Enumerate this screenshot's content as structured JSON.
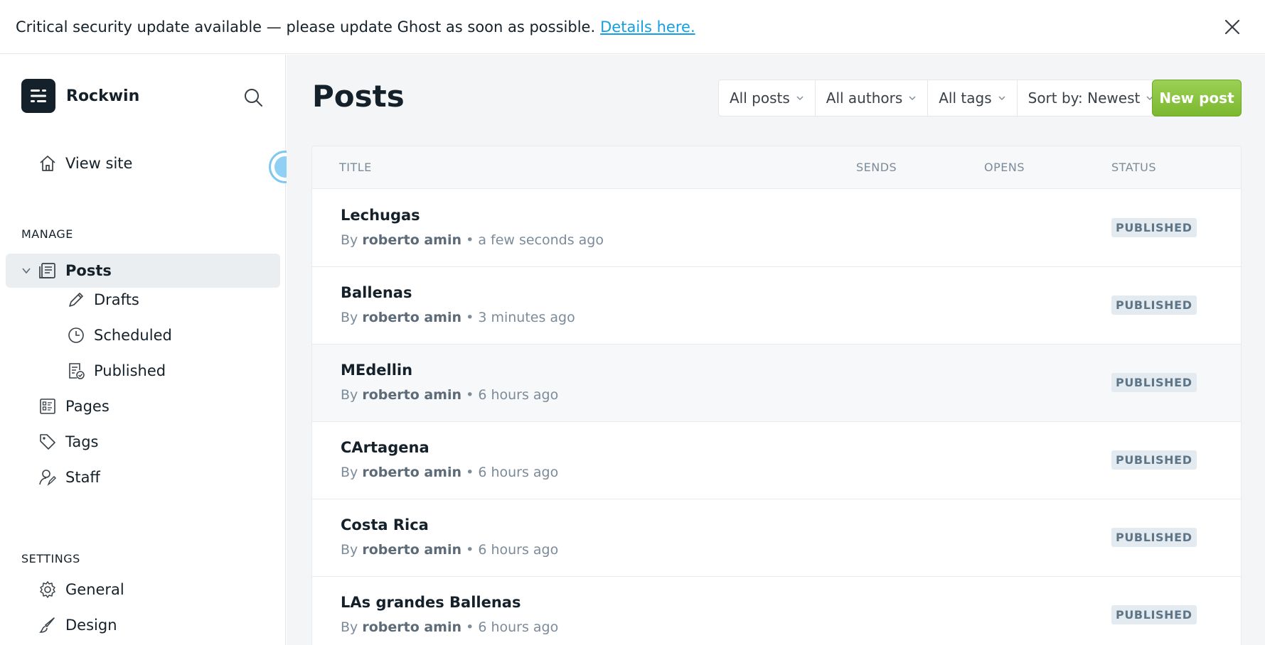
{
  "banner": {
    "message": "Critical security update available — please update Ghost as soon as possible.",
    "link": "Details here."
  },
  "sidebar": {
    "brand": "Rockwin",
    "view_site": "View site",
    "manage_label": "MANAGE",
    "posts": "Posts",
    "drafts": "Drafts",
    "scheduled": "Scheduled",
    "published": "Published",
    "pages": "Pages",
    "tags": "Tags",
    "staff": "Staff",
    "settings_label": "SETTINGS",
    "general": "General",
    "design": "Design"
  },
  "main": {
    "title": "Posts",
    "filters": [
      "All posts",
      "All authors",
      "All tags",
      "Sort by: Newest"
    ],
    "new_post": "New post",
    "columns": {
      "title": "TITLE",
      "sends": "SENDS",
      "opens": "OPENS",
      "status": "STATUS"
    },
    "posts": [
      {
        "title": "Lechugas",
        "by": "By",
        "author": "roberto amin",
        "time": "• a few seconds ago",
        "status": "PUBLISHED"
      },
      {
        "title": "Ballenas",
        "by": "By",
        "author": "roberto amin",
        "time": "• 3 minutes ago",
        "status": "PUBLISHED"
      },
      {
        "title": "MEdellin",
        "by": "By",
        "author": "roberto amin",
        "time": "• 6 hours ago",
        "status": "PUBLISHED"
      },
      {
        "title": "CArtagena",
        "by": "By",
        "author": "roberto amin",
        "time": "• 6 hours ago",
        "status": "PUBLISHED"
      },
      {
        "title": "Costa Rica",
        "by": "By",
        "author": "roberto amin",
        "time": "• 6 hours ago",
        "status": "PUBLISHED"
      },
      {
        "title": "LAs grandes Ballenas",
        "by": "By",
        "author": "roberto amin",
        "time": "• 6 hours ago",
        "status": "PUBLISHED"
      }
    ]
  },
  "colors": {
    "accent_green": "#8bc34a",
    "link_blue": "#14a0e0",
    "dark": "#15212a"
  }
}
